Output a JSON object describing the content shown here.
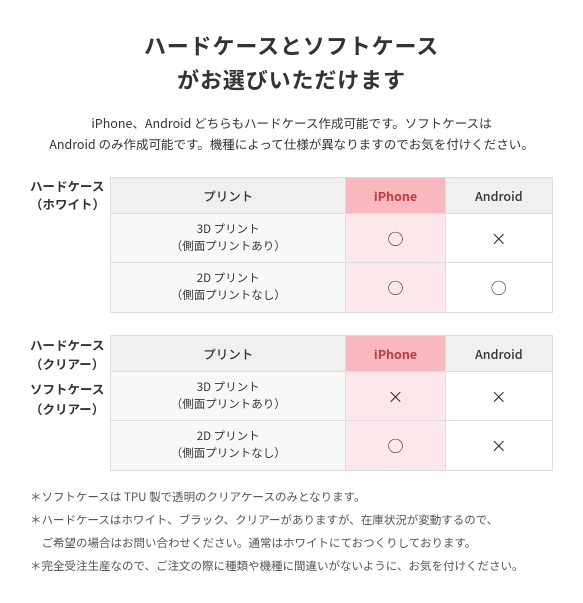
{
  "page": {
    "title_line1": "ハードケースとソフトケース",
    "title_line2": "がお選びいただけます",
    "subtitle": "iPhone、Android どちらもハードケース作成可能です。ソフトケースは\nAndroid のみ作成可能です。機種によって仕様が異なりますのでお気を付けください。",
    "table1": {
      "left_label_line1": "ハードケース",
      "left_label_line2": "（ホワイト）",
      "header": {
        "print": "プリント",
        "iphone": "iPhone",
        "android": "Android"
      },
      "rows": [
        {
          "print": "3D プリント\n（側面プリントあり）",
          "iphone": "○",
          "android": "×"
        },
        {
          "print": "2D プリント\n（側面プリントなし）",
          "iphone": "○",
          "android": "○"
        }
      ]
    },
    "table2": {
      "left_label_line1": "ハードケース",
      "left_label_line2": "（クリアー）",
      "left_label_line3": "ソフトケース",
      "left_label_line4": "（クリアー）",
      "header": {
        "print": "プリント",
        "iphone": "iPhone",
        "android": "Android"
      },
      "rows": [
        {
          "print": "3D プリント\n（側面プリントあり）",
          "iphone": "×",
          "android": "×"
        },
        {
          "print": "2D プリント\n（側面プリントなし）",
          "iphone": "○",
          "android": "×"
        }
      ]
    },
    "notes": [
      "＊ソフトケースは TPU 製で透明のクリアケースのみとなります。",
      "＊ハードケースはホワイト、ブラック、クリアーがありますが、在庫状況が変動するので、",
      "　ご希望の場合はお問い合わせください。通常はホワイトにておつくりしております。",
      "＊完全受注生産なので、ご注文の際に種類や機種に間違いがないように、お気を付けください。"
    ]
  }
}
